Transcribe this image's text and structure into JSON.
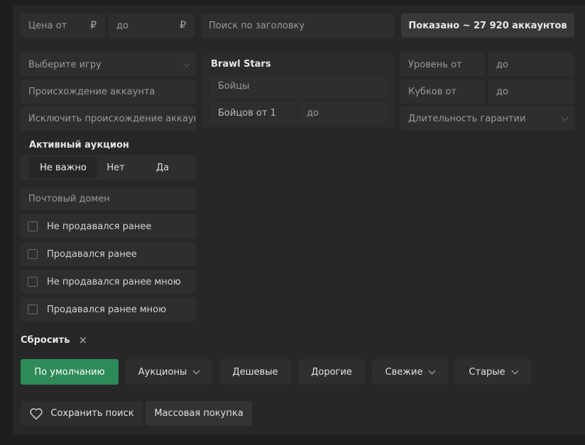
{
  "price": {
    "from_placeholder": "Цена от",
    "to_placeholder": "до",
    "currency": "₽"
  },
  "search": {
    "placeholder": "Поиск по заголовку"
  },
  "results": {
    "shown_label": "Показано ~ 27 920 аккаунтов"
  },
  "game": {
    "placeholder": "Выберите игру"
  },
  "origin": {
    "placeholder": "Происхождение аккаунта"
  },
  "exclude_origin": {
    "placeholder": "Исключить происхождение аккаунт"
  },
  "auction": {
    "title": "Активный аукцион",
    "options": [
      "Не важно",
      "Нет",
      "Да"
    ],
    "selected": "Не важно"
  },
  "email_domain": {
    "placeholder": "Почтовый домен"
  },
  "checkboxes": [
    {
      "label": "Не продавался ранее",
      "checked": false
    },
    {
      "label": "Продавался ранее",
      "checked": false
    },
    {
      "label": "Не продавался ранее мною",
      "checked": false
    },
    {
      "label": "Продавался ранее мною",
      "checked": false
    }
  ],
  "brawl": {
    "title": "Brawl Stars",
    "fighters_placeholder": "Бойцы",
    "fighters_from_value": "Бойцов от 1",
    "fighters_to_placeholder": "до"
  },
  "level": {
    "from_placeholder": "Уровень от",
    "to_placeholder": "до"
  },
  "cups": {
    "from_placeholder": "Кубков от",
    "to_placeholder": "до"
  },
  "warranty": {
    "placeholder": "Длительность гарантии"
  },
  "reset": {
    "label": "Сбросить",
    "icon": "×"
  },
  "sort": [
    {
      "label": "По умолчанию",
      "active": true,
      "dropdown": false
    },
    {
      "label": "Аукционы",
      "active": false,
      "dropdown": true
    },
    {
      "label": "Дешевые",
      "active": false,
      "dropdown": false
    },
    {
      "label": "Дорогие",
      "active": false,
      "dropdown": false
    },
    {
      "label": "Свежие",
      "active": false,
      "dropdown": true
    },
    {
      "label": "Старые",
      "active": false,
      "dropdown": true
    }
  ],
  "actions": {
    "save_search": "Сохранить поиск",
    "bulk_buy": "Массовая покупка"
  },
  "colors": {
    "accent": "#2e8b57",
    "panel": "#272727",
    "field": "#2e2e2e",
    "background": "#1e1e1e"
  }
}
